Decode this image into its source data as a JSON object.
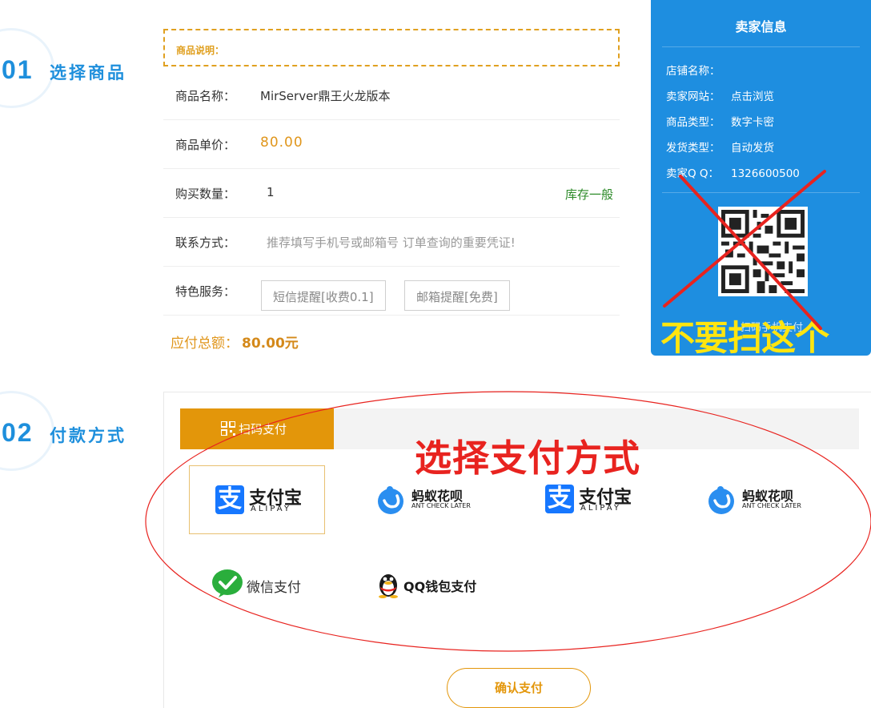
{
  "steps": [
    {
      "number": "01",
      "title": "选择商品"
    },
    {
      "number": "02",
      "title": "付款方式"
    }
  ],
  "product": {
    "description_label": "商品说明：",
    "name_label": "商品名称：",
    "name_value": "MirServer鼎王火龙版本",
    "price_label": "商品单价：",
    "price_value": "80.00",
    "quantity_label": "购买数量：",
    "quantity_value": "1",
    "stock_status": "库存一般",
    "contact_label": "联系方式：",
    "contact_placeholder": "推荐填写手机号或邮箱号 订单查询的重要凭证!",
    "service_label": "特色服务：",
    "services": [
      "短信提醒[收费0.1]",
      "邮箱提醒[免费]"
    ],
    "total_label": "应付总额：",
    "total_value": "80.00元"
  },
  "seller": {
    "title": "卖家信息",
    "rows": [
      {
        "key": "店铺名称：",
        "value": ""
      },
      {
        "key": "卖家网站：",
        "value": "点击浏览"
      },
      {
        "key": "商品类型：",
        "value": "数字卡密"
      },
      {
        "key": "发货类型：",
        "value": "自动发货"
      },
      {
        "key": "卖家Q Q：",
        "value": "1326600500"
      }
    ],
    "qr_caption": "扫码手机支付",
    "warning": "不要扫这个"
  },
  "payment": {
    "tab_label": "扫码支付",
    "choose_hint": "选择支付方式",
    "options": [
      {
        "brand": "alipay",
        "cn": "支付宝",
        "en": "ALIPAY",
        "selected": true
      },
      {
        "brand": "huabei",
        "cn": "蚂蚁花呗",
        "en": "ANT CHECK LATER"
      },
      {
        "brand": "alipay",
        "cn": "支付宝",
        "en": "ALIPAY"
      },
      {
        "brand": "huabei",
        "cn": "蚂蚁花呗",
        "en": "ANT CHECK LATER"
      },
      {
        "brand": "wechat",
        "cn": "微信支付"
      },
      {
        "brand": "qq",
        "cn": "QQ钱包支付"
      }
    ],
    "confirm_label": "确认支付"
  },
  "colors": {
    "accent_blue": "#1e8ee0",
    "accent_orange": "#e3960a",
    "annotation_red": "#e8231f",
    "annotation_yellow": "#ffe510",
    "stock_green": "#2c8a28"
  },
  "icons": {
    "alipay": "alipay-logo-icon",
    "huabei": "huabei-logo-icon",
    "wechat": "wechat-check-icon",
    "qq": "qq-penguin-icon",
    "tab": "qr-icon"
  }
}
